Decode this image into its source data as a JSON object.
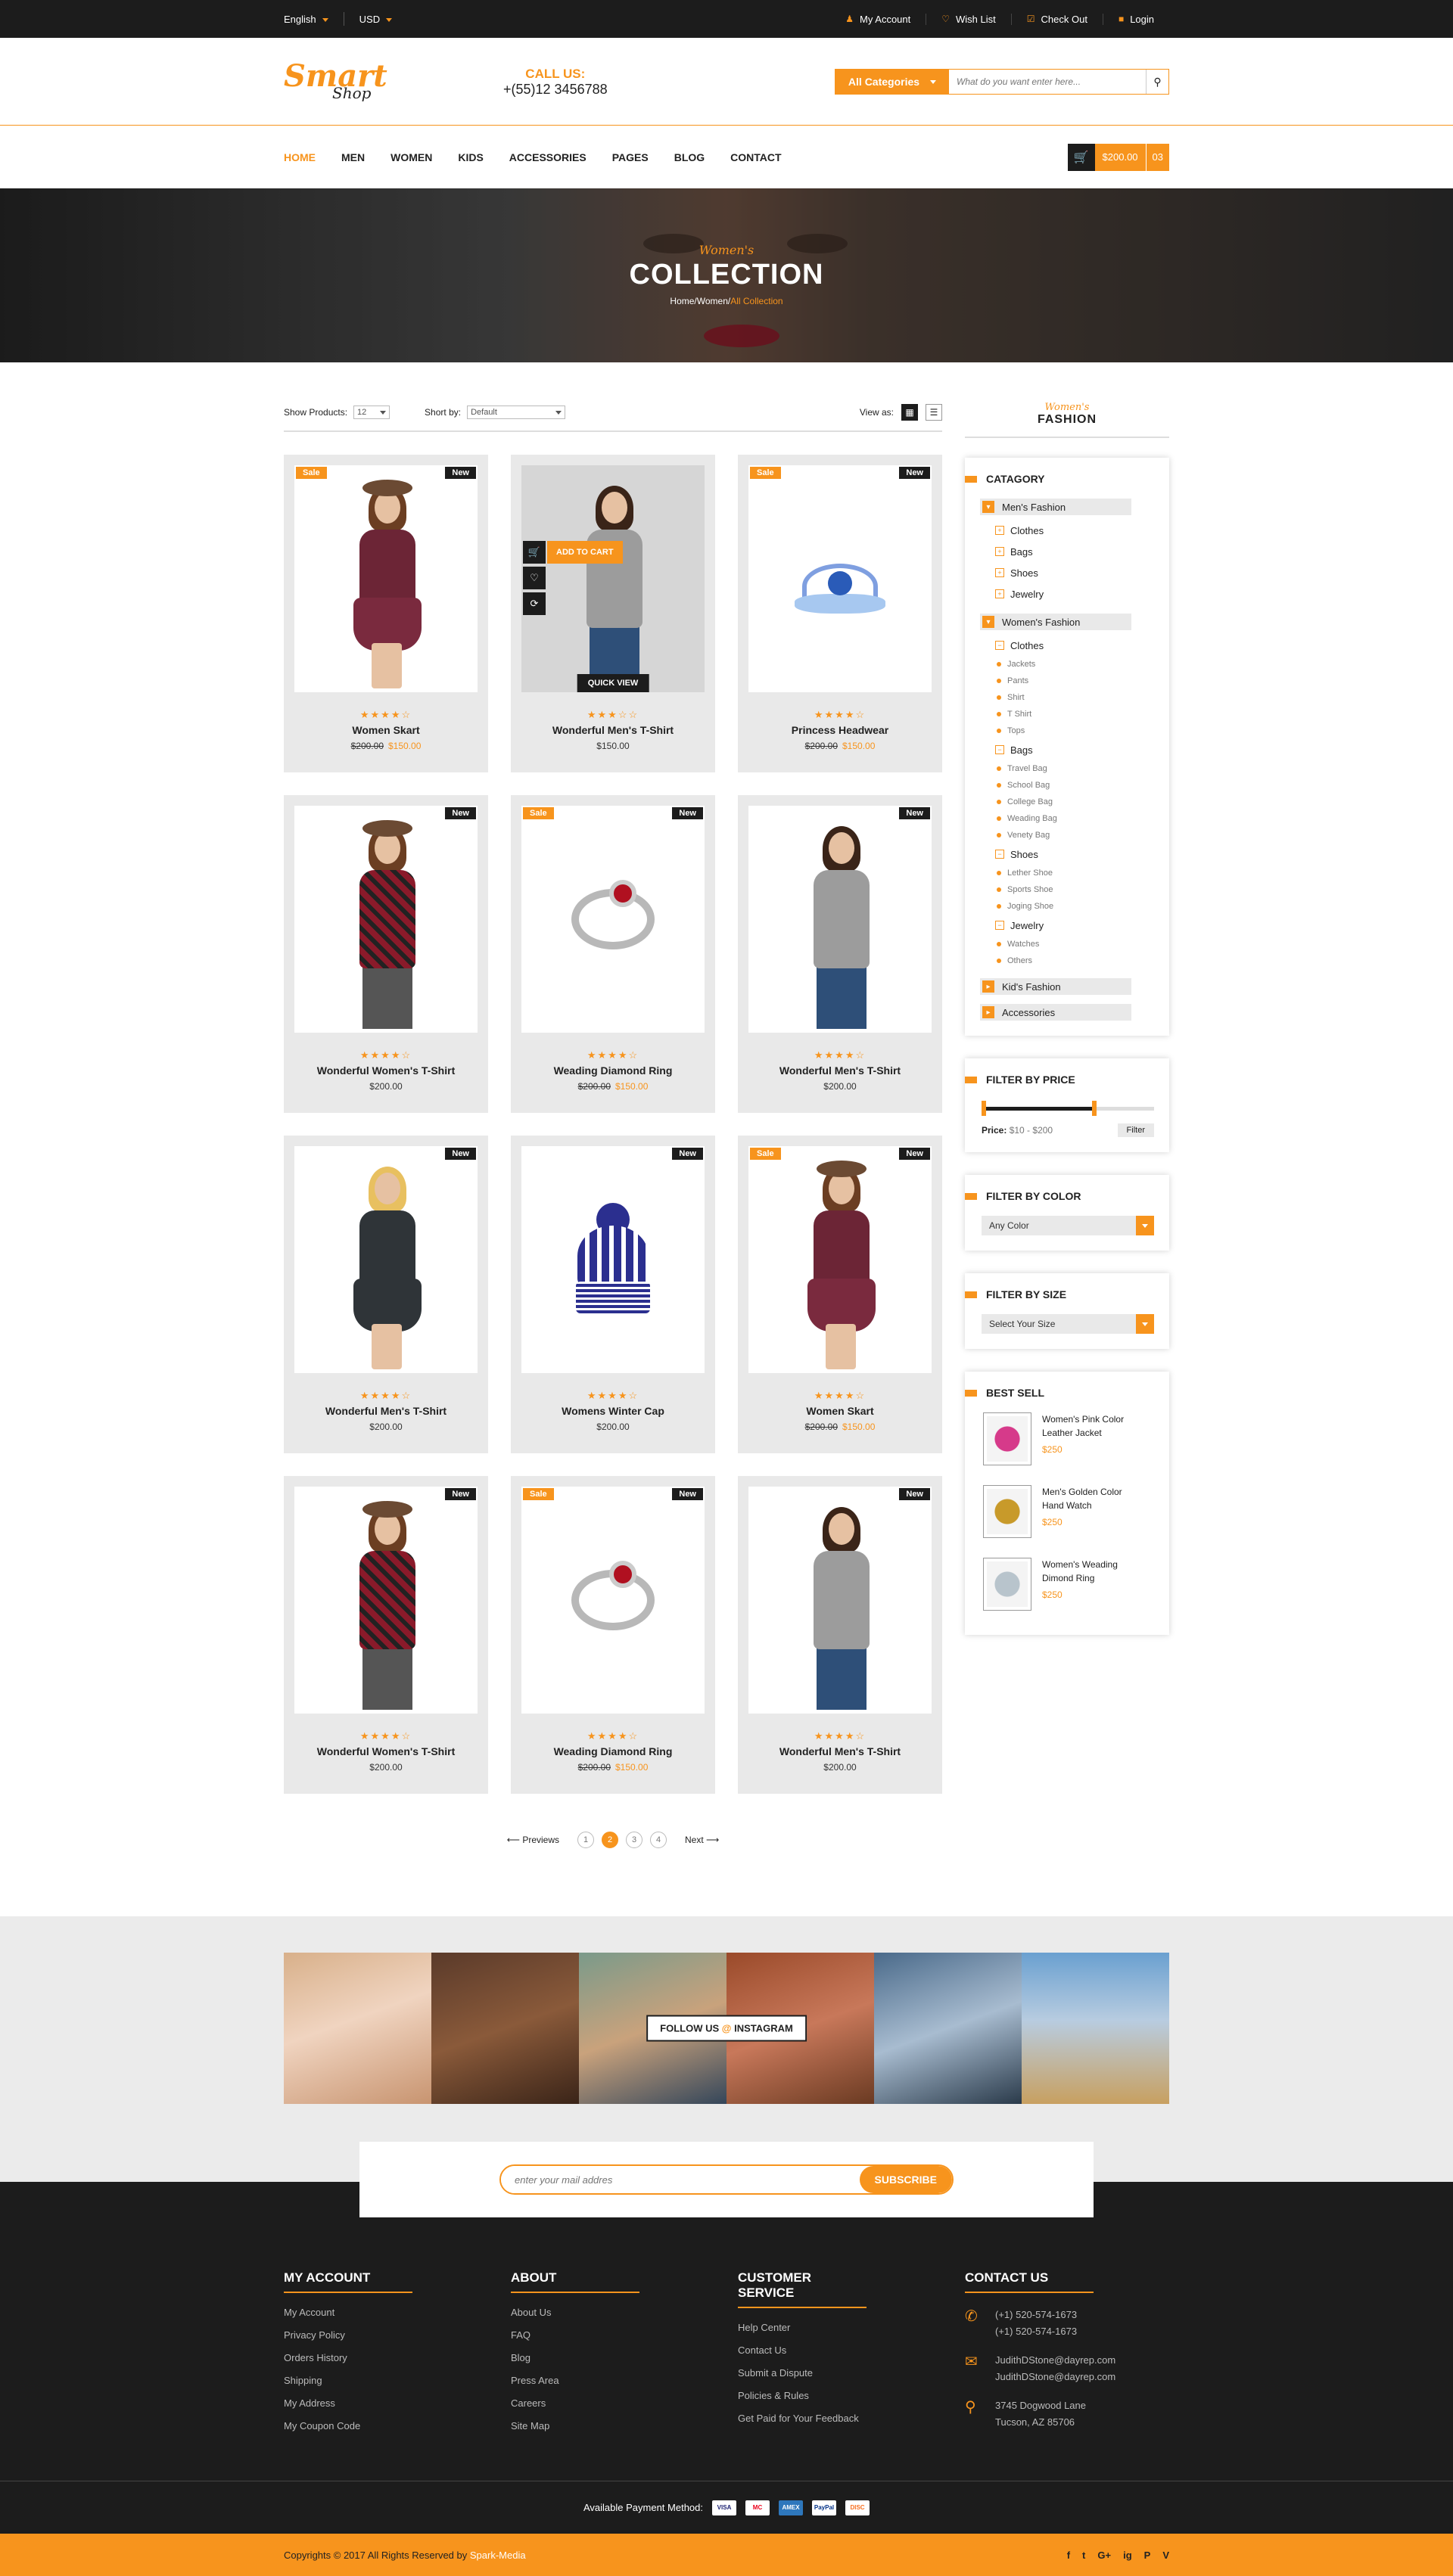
{
  "topbar": {
    "language": "English",
    "currency": "USD",
    "links": [
      {
        "label": "My Account",
        "icon": "user-icon"
      },
      {
        "label": "Wish List",
        "icon": "heart-icon"
      },
      {
        "label": "Check Out",
        "icon": "checkout-icon"
      },
      {
        "label": "Login",
        "icon": "lock-icon"
      }
    ]
  },
  "header": {
    "logo_top": "Smart",
    "logo_bottom": "Shop",
    "call_title": "CALL US:",
    "phone": "+(55)12 3456788",
    "search_category": "All Categories",
    "search_placeholder": "What do you want enter here..."
  },
  "nav": {
    "items": [
      "HOME",
      "MEN",
      "WOMEN",
      "KIDS",
      "ACCESSORIES",
      "PAGES",
      "BLOG",
      "CONTACT"
    ],
    "cart_amount": "$200.00",
    "cart_count": "03"
  },
  "banner": {
    "subtitle": "Women's",
    "title": "COLLECTION",
    "crumbs": [
      "Home/",
      "Women/"
    ],
    "current": "All Collection"
  },
  "toolbar": {
    "show_label": "Show Products:",
    "show_value": "12",
    "sort_label": "Short by:",
    "sort_value": "Default",
    "view_label": "View as:"
  },
  "products": [
    {
      "name": "Women Skart",
      "old": "$200.00",
      "price": "$150.00",
      "sale": true,
      "new": true,
      "rating": 4
    },
    {
      "name": "Wonderful Men's T-Shirt",
      "old": "",
      "price": "$150.00",
      "sale": false,
      "new": false,
      "rating": 3,
      "add_to_cart": "ADD TO CART",
      "quick_view": "QUICK VIEW"
    },
    {
      "name": "Princess Headwear",
      "old": "$200.00",
      "price": "$150.00",
      "sale": true,
      "new": true,
      "rating": 4
    },
    {
      "name": "Wonderful Women's T-Shirt",
      "old": "",
      "price": "$200.00",
      "sale": false,
      "new": true,
      "rating": 4
    },
    {
      "name": "Weading Diamond Ring",
      "old": "$200.00",
      "price": "$150.00",
      "sale": true,
      "new": true,
      "rating": 4
    },
    {
      "name": "Wonderful Men's T-Shirt",
      "old": "",
      "price": "$200.00",
      "sale": false,
      "new": true,
      "rating": 4
    },
    {
      "name": "Wonderful Men's T-Shirt",
      "old": "",
      "price": "$200.00",
      "sale": false,
      "new": true,
      "rating": 4
    },
    {
      "name": "Womens Winter Cap",
      "old": "",
      "price": "$200.00",
      "sale": false,
      "new": true,
      "rating": 4
    },
    {
      "name": "Women Skart",
      "old": "$200.00",
      "price": "$150.00",
      "sale": true,
      "new": true,
      "rating": 4
    },
    {
      "name": "Wonderful Women's T-Shirt",
      "old": "",
      "price": "$200.00",
      "sale": false,
      "new": true,
      "rating": 4
    },
    {
      "name": "Weading Diamond Ring",
      "old": "$200.00",
      "price": "$150.00",
      "sale": true,
      "new": true,
      "rating": 4
    },
    {
      "name": "Wonderful Men's T-Shirt",
      "old": "",
      "price": "$200.00",
      "sale": false,
      "new": true,
      "rating": 4
    }
  ],
  "badges": {
    "sale": "Sale",
    "new": "New"
  },
  "pagination": {
    "prev": "Previews",
    "pages": [
      "1",
      "2",
      "3",
      "4"
    ],
    "current": 2,
    "next": "Next"
  },
  "sidebar": {
    "head_sub": "Women's",
    "head_title": "FASHION",
    "category_title": "CATAGORY",
    "mens": "Men's Fashion",
    "mens_sub": [
      "Clothes",
      "Bags",
      "Shoes",
      "Jewelry"
    ],
    "womens": "Women's Fashion",
    "womens_groups": [
      {
        "name": "Clothes",
        "items": [
          "Jackets",
          "Pants",
          "Shirt",
          "T Shirt",
          "Tops"
        ]
      },
      {
        "name": "Bags",
        "items": [
          "Travel Bag",
          "School Bag",
          "College Bag",
          "Weading Bag",
          "Venety Bag"
        ]
      },
      {
        "name": "Shoes",
        "items": [
          "Lether Shoe",
          "Sports Shoe",
          "Joging Shoe"
        ]
      },
      {
        "name": "Jewelry",
        "items": [
          "Watches",
          "Others"
        ]
      }
    ],
    "kids": "Kid's Fashion",
    "accessories": "Accessories",
    "price_title": "FILTER BY PRICE",
    "price_label": "Price:",
    "price_range": "$10 - $200",
    "filter_btn": "Filter",
    "color_title": "FILTER BY COLOR",
    "color_value": "Any Color",
    "size_title": "FILTER BY SIZE",
    "size_value": "Select Your Size",
    "best_title": "BEST SELL",
    "best": [
      {
        "name1": "Women's Pink Color",
        "name2": "Leather Jacket",
        "price": "$250",
        "color": "#d63a8a"
      },
      {
        "name1": "Men's Golden Color",
        "name2": "Hand Watch",
        "price": "$250",
        "color": "#c89a2a"
      },
      {
        "name1": "Women's Weading",
        "name2": "Dimond Ring",
        "price": "$250",
        "color": "#b8c4cc"
      }
    ]
  },
  "instagram": {
    "label1": "FOLLOW US",
    "at": "@",
    "label2": "INSTAGRAM"
  },
  "newsletter": {
    "placeholder": "enter your mail addres",
    "button": "SUBSCRIBE"
  },
  "footer": {
    "account_title": "MY ACCOUNT",
    "account_links": [
      "My Account",
      "Privacy Policy",
      "Orders History",
      "Shipping",
      "My Address",
      "My Coupon Code"
    ],
    "about_title": "ABOUT",
    "about_links": [
      "About Us",
      "FAQ",
      "Blog",
      "Press Area",
      "Careers",
      "Site Map"
    ],
    "service_title": "CUSTOMER SERVICE",
    "service_links": [
      "Help Center",
      "Contact Us",
      "Submit a Dispute",
      "Policies & Rules",
      "Get Paid for Your Feedback"
    ],
    "contact_title": "CONTACT US",
    "phones": [
      "(+1) 520-574-1673",
      "(+1) 520-574-1673"
    ],
    "emails": [
      "JudithDStone@dayrep.com",
      "JudithDStone@dayrep.com"
    ],
    "address": [
      "3745 Dogwood Lane",
      "Tucson, AZ 85706"
    ],
    "payment_label": "Available Payment Method:",
    "payments": [
      "VISA",
      "MC",
      "AMEX",
      "PayPal",
      "DISC"
    ],
    "copyright": "Copyrights © 2017 All Rights Reserved by ",
    "brand": "Spark-Media",
    "social": [
      "f",
      "t",
      "G+",
      "ig",
      "P",
      "V"
    ]
  },
  "colors": {
    "accent": "#f7941d",
    "dark": "#1c1c1c"
  }
}
